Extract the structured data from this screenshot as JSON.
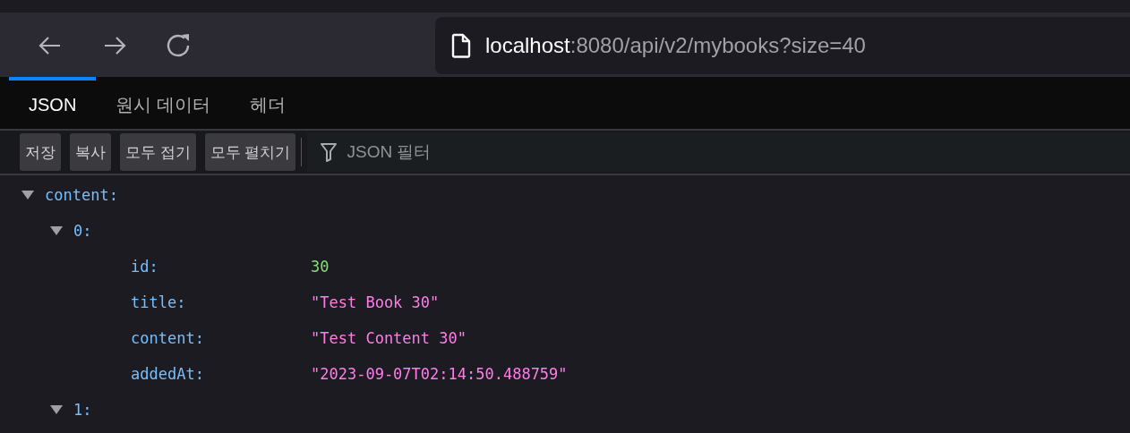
{
  "address_bar": {
    "host": "localhost",
    "path": ":8080/api/v2/mybooks?size=40"
  },
  "tabs": [
    {
      "label": "JSON",
      "selected": true
    },
    {
      "label": "원시 데이터",
      "selected": false
    },
    {
      "label": "헤더",
      "selected": false
    }
  ],
  "toolbar": {
    "buttons": [
      "저장",
      "복사",
      "모두 접기",
      "모두 펼치기"
    ],
    "filter": {
      "placeholder": "JSON 필터"
    }
  },
  "tree": [
    {
      "key": "content:",
      "expanded": true,
      "children": [
        {
          "key": "0:",
          "expanded": true,
          "children": [
            {
              "key": "id:",
              "value": "30",
              "kind": "number"
            },
            {
              "key": "title:",
              "value": "\"Test Book 30\"",
              "kind": "string"
            },
            {
              "key": "content:",
              "value": "\"Test Content 30\"",
              "kind": "string"
            },
            {
              "key": "addedAt:",
              "value": "\"2023-09-07T02:14:50.488759\"",
              "kind": "string"
            }
          ]
        },
        {
          "key": "1:",
          "expanded": true
        }
      ]
    }
  ]
}
